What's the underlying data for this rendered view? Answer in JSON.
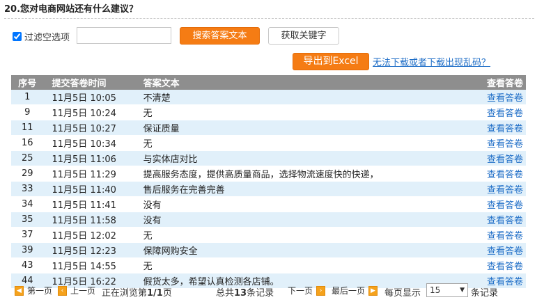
{
  "question": {
    "title": "20.您对电商网站还有什么建议？"
  },
  "filter": {
    "checkbox_label": "过滤空选项",
    "checkbox_checked": true,
    "input_value": "",
    "search_button": "搜索答案文本",
    "keyword_button": "获取关键字"
  },
  "export": {
    "button": "导出到Excel",
    "help_link": "无法下载或者下载出现乱码？"
  },
  "table": {
    "headers": {
      "no": "序号",
      "time": "提交答卷时间",
      "text": "答案文本",
      "view": "查看答卷"
    },
    "rows": [
      {
        "no": "1",
        "time": "11月5日 10:05",
        "text": "不清楚",
        "view": "查看答卷"
      },
      {
        "no": "9",
        "time": "11月5日 10:24",
        "text": "无",
        "view": "查看答卷"
      },
      {
        "no": "11",
        "time": "11月5日 10:27",
        "text": "保证质量",
        "view": "查看答卷"
      },
      {
        "no": "16",
        "time": "11月5日 10:34",
        "text": "无",
        "view": "查看答卷"
      },
      {
        "no": "25",
        "time": "11月5日 11:06",
        "text": "与实体店对比",
        "view": "查看答卷"
      },
      {
        "no": "29",
        "time": "11月5日 11:29",
        "text": "提高服务态度，提供高质量商品，选择物流速度快的快递，",
        "view": "查看答卷"
      },
      {
        "no": "33",
        "time": "11月5日 11:40",
        "text": "售后服务在完善完善",
        "view": "查看答卷"
      },
      {
        "no": "34",
        "time": "11月5日 11:41",
        "text": "没有",
        "view": "查看答卷"
      },
      {
        "no": "35",
        "time": "11月5日 11:58",
        "text": "没有",
        "view": "查看答卷"
      },
      {
        "no": "37",
        "time": "11月5日 12:02",
        "text": "无",
        "view": "查看答卷"
      },
      {
        "no": "39",
        "time": "11月5日 12:23",
        "text": "保障网购安全",
        "view": "查看答卷"
      },
      {
        "no": "43",
        "time": "11月5日 14:55",
        "text": "无",
        "view": "查看答卷"
      },
      {
        "no": "44",
        "time": "11月5日 16:22",
        "text": "假货太多，希望认真检测各店铺。",
        "view": "查看答卷"
      }
    ]
  },
  "pager": {
    "first": "第一页",
    "prev": "上一页",
    "browsing_prefix": "正在浏览第",
    "browsing_page": "1/1",
    "browsing_suffix": "页",
    "total_prefix": "总共",
    "total_count": "13",
    "total_suffix": "条记录",
    "next": "下一页",
    "last": "最后一页",
    "per_page_label": "每页显示",
    "per_page_value": "15",
    "per_page_suffix": "条记录"
  },
  "colors": {
    "accent_orange": "#f57c14",
    "link_blue": "#1f6ec7",
    "header_gray": "#8e8e8e",
    "row_blue": "#e1f0fa"
  }
}
